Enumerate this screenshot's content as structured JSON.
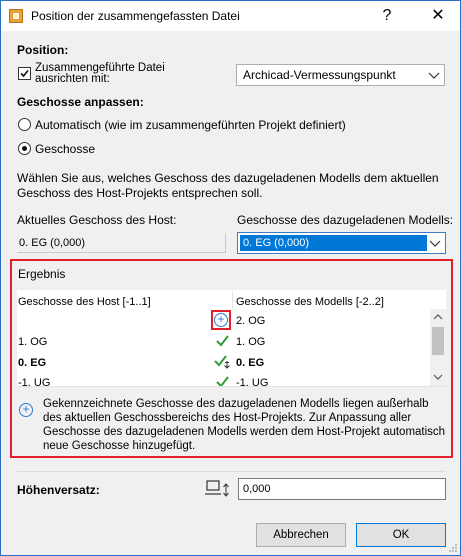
{
  "window": {
    "title": "Position der zusammengefassten Datei",
    "help_label": "?",
    "close_label": "✕"
  },
  "position": {
    "heading": "Position:",
    "align_checkbox_label_line1": "Zusammengeführte Datei",
    "align_checkbox_label_line2": "ausrichten mit:",
    "align_checked": true,
    "align_target": "Archicad-Vermessungspunkt"
  },
  "stories": {
    "heading": "Geschosse anpassen:",
    "option_auto": "Automatisch (wie im zusammengeführten Projekt definiert)",
    "option_stories": "Geschosse",
    "selected": "Geschosse",
    "instruction": "Wählen Sie aus, welches Geschoss des dazugeladenen Modells dem aktuellen Geschoss des Host-Projekts entsprechen soll.",
    "host_label": "Aktuelles Geschoss des Host:",
    "host_value": "0. EG (0,000)",
    "merged_label": "Geschosse des dazugeladenen Modells:",
    "merged_value": "0. EG (0,000)"
  },
  "result": {
    "heading": "Ergebnis",
    "host_col_header": "Geschosse des Host [-1..1]",
    "merged_col_header": "Geschosse des Modells [-2..2]",
    "rows": [
      {
        "host": "",
        "status": "add",
        "merged": "2. OG",
        "bold": false
      },
      {
        "host": "1. OG",
        "status": "ok",
        "merged": "1. OG",
        "bold": false
      },
      {
        "host": "0. EG",
        "status": "ok-anchor",
        "merged": "0. EG",
        "bold": true
      },
      {
        "host": "-1. UG",
        "status": "ok",
        "merged": "-1. UG",
        "bold": false
      }
    ],
    "info": "Gekennzeichnete Geschosse des dazugeladenen Modells liegen außerhalb des aktuellen Geschossbereichs des Host-Projekts. Zur Anpassung aller Geschosse des dazugeladenen Modells werden dem Host-Projekt automatisch neue Geschosse hinzugefügt."
  },
  "offset": {
    "label": "Höhenversatz:",
    "value": "0,000"
  },
  "buttons": {
    "cancel": "Abbrechen",
    "ok": "OK"
  },
  "colors": {
    "accent": "#0078d7",
    "highlight_border": "#e0202a",
    "check_green": "#2e9e3a",
    "info_blue": "#2a7ad5"
  }
}
